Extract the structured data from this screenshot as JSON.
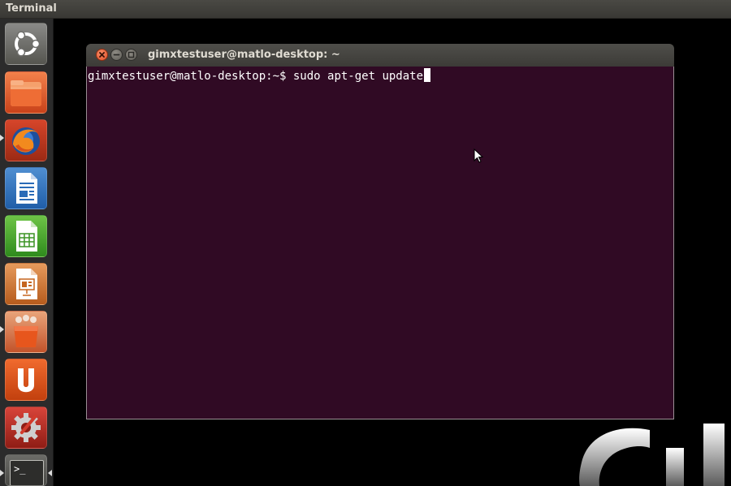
{
  "top_panel": {
    "title": "Terminal"
  },
  "launcher": {
    "items": [
      {
        "name": "dash-home",
        "icon": "ubuntu-logo-icon"
      },
      {
        "name": "files",
        "icon": "folder-icon"
      },
      {
        "name": "firefox",
        "icon": "firefox-icon"
      },
      {
        "name": "libreoffice-writer",
        "icon": "writer-document-icon"
      },
      {
        "name": "libreoffice-calc",
        "icon": "calc-spreadsheet-icon"
      },
      {
        "name": "libreoffice-impress",
        "icon": "impress-presentation-icon"
      },
      {
        "name": "software-center",
        "icon": "shopping-bag-icon"
      },
      {
        "name": "ubuntu-one",
        "icon": "ubuntu-one-icon"
      },
      {
        "name": "system-settings",
        "icon": "settings-gear-icon"
      },
      {
        "name": "terminal",
        "icon": "terminal-icon"
      }
    ],
    "terminal_icon_text": ">_"
  },
  "window": {
    "title": "gimxtestuser@matlo-desktop: ~",
    "prompt": "gimxtestuser@matlo-desktop:~$ ",
    "command": "sudo apt-get update"
  },
  "colors": {
    "terminal_bg": "#300a24",
    "panel_bg": "#3c3b37",
    "launcher_bg": "#2b2b2b",
    "close_button": "#e0512a"
  }
}
